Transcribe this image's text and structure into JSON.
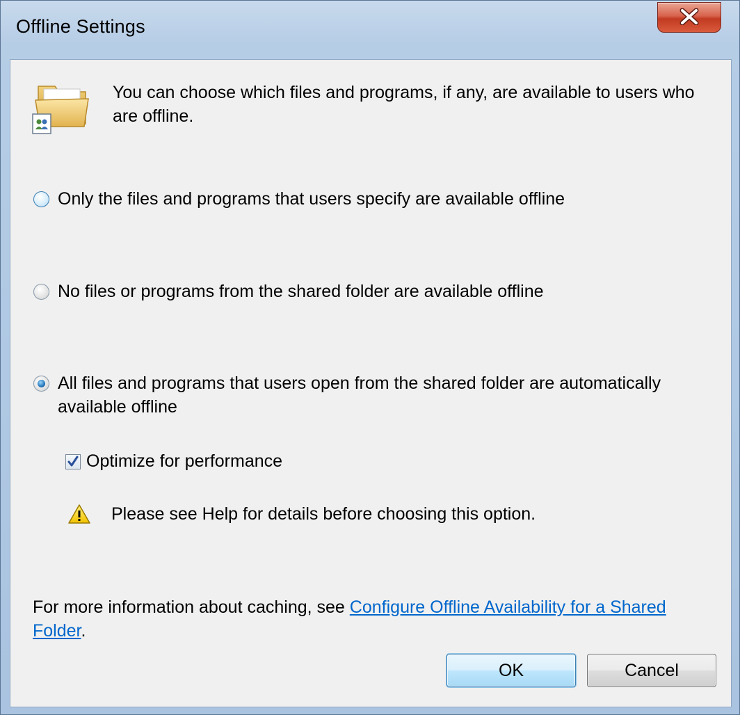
{
  "window": {
    "title": "Offline Settings",
    "close_glyph": "X"
  },
  "intro": {
    "text": "You can choose which files and programs, if any, are available to users who are offline.",
    "icon": "shared-folder-icon"
  },
  "options": [
    {
      "label": "Only the files and programs that users specify are available offline",
      "selected": false
    },
    {
      "label": "No files or programs from the shared folder are available offline",
      "selected": false
    },
    {
      "label": "All files and programs that users open from the shared folder are automatically available offline",
      "selected": true
    }
  ],
  "optimize": {
    "label": "Optimize for performance",
    "checked": true
  },
  "warning": {
    "icon": "warning-icon",
    "text": "Please see Help for details before choosing this option."
  },
  "footer": {
    "prefix": "For more information about caching, see ",
    "link_text": "Configure Offline Availability for a Shared Folder",
    "suffix": "."
  },
  "buttons": {
    "ok": "OK",
    "cancel": "Cancel"
  },
  "colors": {
    "link": "#0066cc",
    "close_button": "#c23b22",
    "default_button_border": "#3c7fb1"
  }
}
